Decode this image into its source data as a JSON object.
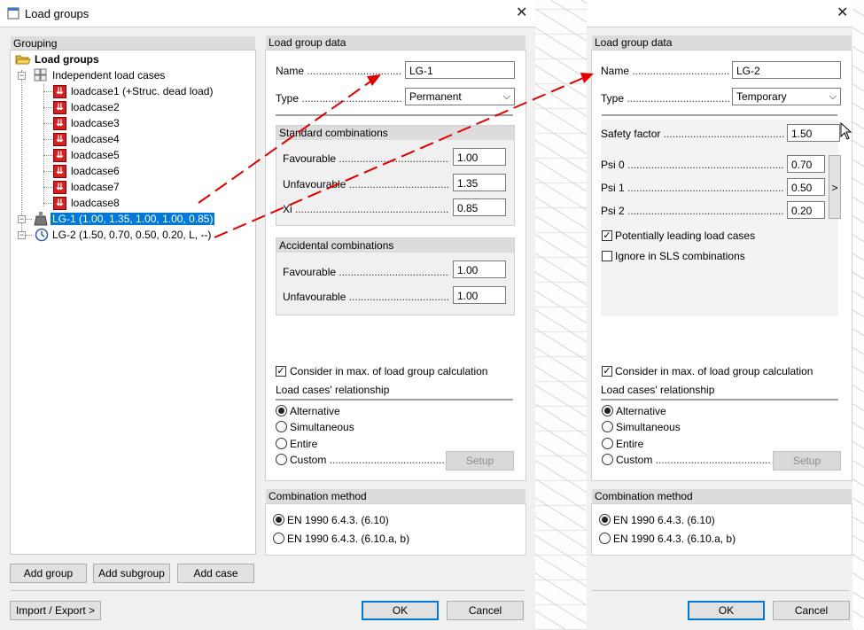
{
  "main_dialog": {
    "title": "Load groups",
    "grouping_label": "Grouping",
    "tree": {
      "root": "Load groups",
      "independent": "Independent load cases",
      "loadcases": [
        "loadcase1  (+Struc. dead load)",
        "loadcase2",
        "loadcase3",
        "loadcase4",
        "loadcase5",
        "loadcase6",
        "loadcase7",
        "loadcase8"
      ],
      "lg1": "LG-1  (1.00, 1.35, 1.00, 1.00, 0.85)",
      "lg2": "LG-2  (1.50, 0.70, 0.50, 0.20, L, --)"
    },
    "buttons": {
      "add_group": "Add group",
      "add_subgroup": "Add subgroup",
      "add_case": "Add case",
      "import_export": "Import / Export >",
      "ok": "OK",
      "cancel": "Cancel"
    },
    "load_group_data": {
      "header": "Load group data",
      "name_label": "Name",
      "name_value": "LG-1",
      "type_label": "Type",
      "type_value": "Permanent",
      "standard": {
        "header": "Standard combinations",
        "favourable_label": "Favourable",
        "favourable_value": "1.00",
        "unfavourable_label": "Unfavourable",
        "unfavourable_value": "1.35",
        "xi_label": "Xi",
        "xi_value": "0.85"
      },
      "accidental": {
        "header": "Accidental combinations",
        "favourable_label": "Favourable",
        "favourable_value": "1.00",
        "unfavourable_label": "Unfavourable",
        "unfavourable_value": "1.00"
      },
      "consider_label": "Consider in max. of load group calculation",
      "relationship_label": "Load cases' relationship",
      "relationships": [
        "Alternative",
        "Simultaneous",
        "Entire",
        "Custom"
      ],
      "selected_relationship": "Alternative",
      "setup_label": "Setup"
    },
    "combination": {
      "header": "Combination method",
      "options": [
        "EN 1990 6.4.3. (6.10)",
        "EN 1990 6.4.3. (6.10.a, b)"
      ]
    }
  },
  "second_dialog": {
    "header": "Load group data",
    "name_label": "Name",
    "name_value": "LG-2",
    "type_label": "Type",
    "type_value": "Temporary",
    "safety_label": "Safety factor",
    "safety_value": "1.50",
    "psi0_label": "Psi 0",
    "psi0_value": "0.70",
    "psi1_label": "Psi 1",
    "psi1_value": "0.50",
    "psi2_label": "Psi 2",
    "psi2_value": "0.20",
    "psi_button": ">",
    "leading_label": "Potentially leading load cases",
    "ignore_sls_label": "Ignore in SLS combinations",
    "consider_label": "Consider in max. of load group calculation",
    "relationship_label": "Load cases' relationship",
    "relationships": [
      "Alternative",
      "Simultaneous",
      "Entire",
      "Custom"
    ],
    "setup_label": "Setup",
    "combination_header": "Combination method",
    "combination_options": [
      "EN 1990 6.4.3. (6.10)",
      "EN 1990 6.4.3. (6.10.a, b)"
    ],
    "ok": "OK",
    "cancel": "Cancel"
  },
  "colors": {
    "arrow": "#e00000",
    "selection": "#0078d7"
  }
}
